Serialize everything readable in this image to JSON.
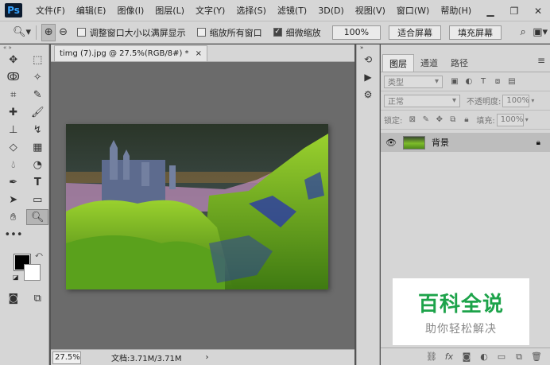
{
  "app": {
    "logo": "Ps"
  },
  "menu": [
    "文件(F)",
    "编辑(E)",
    "图像(I)",
    "图层(L)",
    "文字(Y)",
    "选择(S)",
    "滤镜(T)",
    "3D(D)",
    "视图(V)",
    "窗口(W)",
    "帮助(H)"
  ],
  "window_controls": {
    "minimize": "▁",
    "restore": "❐",
    "close": "✕"
  },
  "options": {
    "resize_windows": {
      "label": "调整窗口大小以满屏显示",
      "checked": false
    },
    "zoom_all": {
      "label": "缩放所有窗口",
      "checked": false
    },
    "scrubby_zoom": {
      "label": "细微缩放",
      "checked": true
    },
    "btn_100": "100%",
    "btn_fit": "适合屏幕",
    "btn_fill": "填充屏幕"
  },
  "document": {
    "tab_title": "timg (7).jpg @ 27.5%(RGB/8#) *",
    "close": "×",
    "zoom": "27.5%",
    "doc_info": "文档:3.71M/3.71M",
    "arrow": "›"
  },
  "layers_panel": {
    "tabs": [
      "图层",
      "通道",
      "路径"
    ],
    "filter_kind": "类型",
    "blend_mode": "正常",
    "opacity_label": "不透明度:",
    "opacity_value": "100%",
    "lock_label": "锁定:",
    "fill_label": "填充:",
    "fill_value": "100%",
    "layer_name": "背景"
  },
  "watermark": {
    "title": "百科全说",
    "subtitle": "助你轻松解决"
  },
  "colors": {
    "foreground": "#000000",
    "background": "#ffffff",
    "watermark_green": "#1da34a"
  }
}
